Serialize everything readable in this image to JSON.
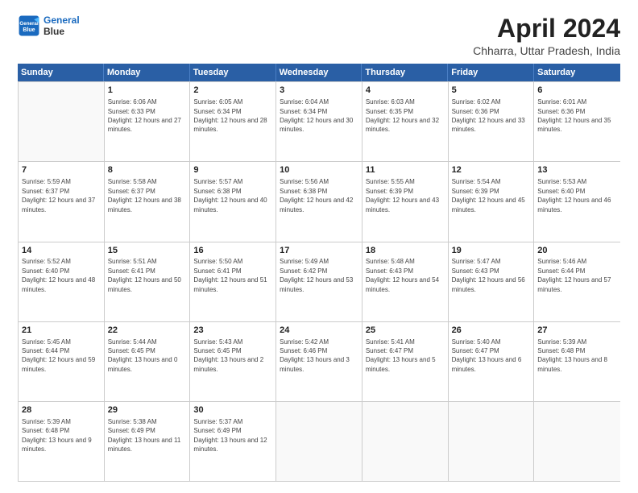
{
  "header": {
    "logo_line1": "General",
    "logo_line2": "Blue",
    "title": "April 2024",
    "subtitle": "Chharra, Uttar Pradesh, India"
  },
  "calendar": {
    "days_of_week": [
      "Sunday",
      "Monday",
      "Tuesday",
      "Wednesday",
      "Thursday",
      "Friday",
      "Saturday"
    ],
    "weeks": [
      [
        {
          "day": "",
          "empty": true
        },
        {
          "day": "1",
          "sunrise": "6:06 AM",
          "sunset": "6:33 PM",
          "daylight": "12 hours and 27 minutes."
        },
        {
          "day": "2",
          "sunrise": "6:05 AM",
          "sunset": "6:34 PM",
          "daylight": "12 hours and 28 minutes."
        },
        {
          "day": "3",
          "sunrise": "6:04 AM",
          "sunset": "6:34 PM",
          "daylight": "12 hours and 30 minutes."
        },
        {
          "day": "4",
          "sunrise": "6:03 AM",
          "sunset": "6:35 PM",
          "daylight": "12 hours and 32 minutes."
        },
        {
          "day": "5",
          "sunrise": "6:02 AM",
          "sunset": "6:36 PM",
          "daylight": "12 hours and 33 minutes."
        },
        {
          "day": "6",
          "sunrise": "6:01 AM",
          "sunset": "6:36 PM",
          "daylight": "12 hours and 35 minutes."
        }
      ],
      [
        {
          "day": "7",
          "sunrise": "5:59 AM",
          "sunset": "6:37 PM",
          "daylight": "12 hours and 37 minutes."
        },
        {
          "day": "8",
          "sunrise": "5:58 AM",
          "sunset": "6:37 PM",
          "daylight": "12 hours and 38 minutes."
        },
        {
          "day": "9",
          "sunrise": "5:57 AM",
          "sunset": "6:38 PM",
          "daylight": "12 hours and 40 minutes."
        },
        {
          "day": "10",
          "sunrise": "5:56 AM",
          "sunset": "6:38 PM",
          "daylight": "12 hours and 42 minutes."
        },
        {
          "day": "11",
          "sunrise": "5:55 AM",
          "sunset": "6:39 PM",
          "daylight": "12 hours and 43 minutes."
        },
        {
          "day": "12",
          "sunrise": "5:54 AM",
          "sunset": "6:39 PM",
          "daylight": "12 hours and 45 minutes."
        },
        {
          "day": "13",
          "sunrise": "5:53 AM",
          "sunset": "6:40 PM",
          "daylight": "12 hours and 46 minutes."
        }
      ],
      [
        {
          "day": "14",
          "sunrise": "5:52 AM",
          "sunset": "6:40 PM",
          "daylight": "12 hours and 48 minutes."
        },
        {
          "day": "15",
          "sunrise": "5:51 AM",
          "sunset": "6:41 PM",
          "daylight": "12 hours and 50 minutes."
        },
        {
          "day": "16",
          "sunrise": "5:50 AM",
          "sunset": "6:41 PM",
          "daylight": "12 hours and 51 minutes."
        },
        {
          "day": "17",
          "sunrise": "5:49 AM",
          "sunset": "6:42 PM",
          "daylight": "12 hours and 53 minutes."
        },
        {
          "day": "18",
          "sunrise": "5:48 AM",
          "sunset": "6:43 PM",
          "daylight": "12 hours and 54 minutes."
        },
        {
          "day": "19",
          "sunrise": "5:47 AM",
          "sunset": "6:43 PM",
          "daylight": "12 hours and 56 minutes."
        },
        {
          "day": "20",
          "sunrise": "5:46 AM",
          "sunset": "6:44 PM",
          "daylight": "12 hours and 57 minutes."
        }
      ],
      [
        {
          "day": "21",
          "sunrise": "5:45 AM",
          "sunset": "6:44 PM",
          "daylight": "12 hours and 59 minutes."
        },
        {
          "day": "22",
          "sunrise": "5:44 AM",
          "sunset": "6:45 PM",
          "daylight": "13 hours and 0 minutes."
        },
        {
          "day": "23",
          "sunrise": "5:43 AM",
          "sunset": "6:45 PM",
          "daylight": "13 hours and 2 minutes."
        },
        {
          "day": "24",
          "sunrise": "5:42 AM",
          "sunset": "6:46 PM",
          "daylight": "13 hours and 3 minutes."
        },
        {
          "day": "25",
          "sunrise": "5:41 AM",
          "sunset": "6:47 PM",
          "daylight": "13 hours and 5 minutes."
        },
        {
          "day": "26",
          "sunrise": "5:40 AM",
          "sunset": "6:47 PM",
          "daylight": "13 hours and 6 minutes."
        },
        {
          "day": "27",
          "sunrise": "5:39 AM",
          "sunset": "6:48 PM",
          "daylight": "13 hours and 8 minutes."
        }
      ],
      [
        {
          "day": "28",
          "sunrise": "5:39 AM",
          "sunset": "6:48 PM",
          "daylight": "13 hours and 9 minutes."
        },
        {
          "day": "29",
          "sunrise": "5:38 AM",
          "sunset": "6:49 PM",
          "daylight": "13 hours and 11 minutes."
        },
        {
          "day": "30",
          "sunrise": "5:37 AM",
          "sunset": "6:49 PM",
          "daylight": "13 hours and 12 minutes."
        },
        {
          "day": "",
          "empty": true
        },
        {
          "day": "",
          "empty": true
        },
        {
          "day": "",
          "empty": true
        },
        {
          "day": "",
          "empty": true
        }
      ]
    ]
  }
}
